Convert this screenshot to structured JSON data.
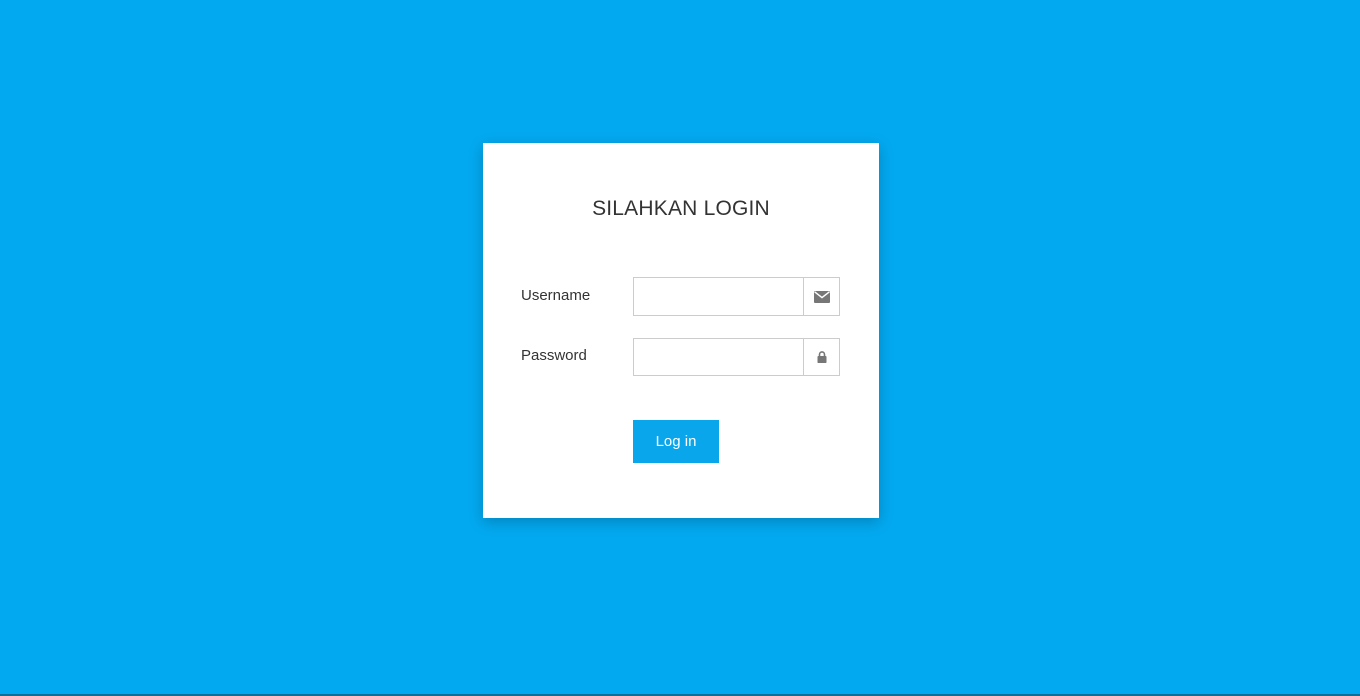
{
  "colors": {
    "page_background": "#03a9f0",
    "card_background": "#ffffff",
    "button_background": "#0aa6ec",
    "button_text": "#ffffff",
    "icon_color": "#777777"
  },
  "login": {
    "title": "SILAHKAN LOGIN",
    "username": {
      "label": "Username",
      "value": "",
      "placeholder": "",
      "icon": "envelope-icon"
    },
    "password": {
      "label": "Password",
      "value": "",
      "placeholder": "",
      "icon": "lock-icon"
    },
    "submit_label": "Log in"
  }
}
